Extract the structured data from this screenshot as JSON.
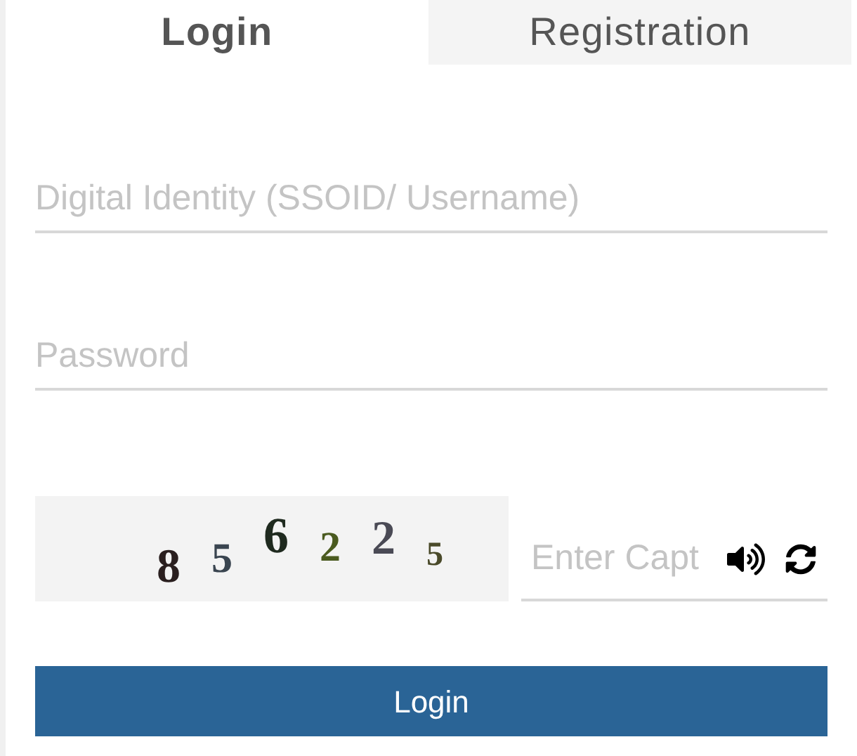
{
  "tabs": [
    {
      "label": "Login",
      "selected": true
    },
    {
      "label": "Registration",
      "selected": false
    }
  ],
  "fields": [
    {
      "placeholder": "Digital Identity (SSOID/ Username)"
    },
    {
      "placeholder": "Password"
    }
  ],
  "captcha": {
    "digits": [
      {
        "text": "8",
        "color": "#2a1f1f"
      },
      {
        "text": "5",
        "color": "#3a4550"
      },
      {
        "text": "6",
        "color": "#1f2a1f"
      },
      {
        "text": "2",
        "color": "#4a5a1f"
      },
      {
        "text": "2",
        "color": "#4a4a55"
      },
      {
        "text": "5",
        "color": "#4a4a2a"
      }
    ],
    "placeholder": "Enter Capt"
  },
  "submit": "Login"
}
